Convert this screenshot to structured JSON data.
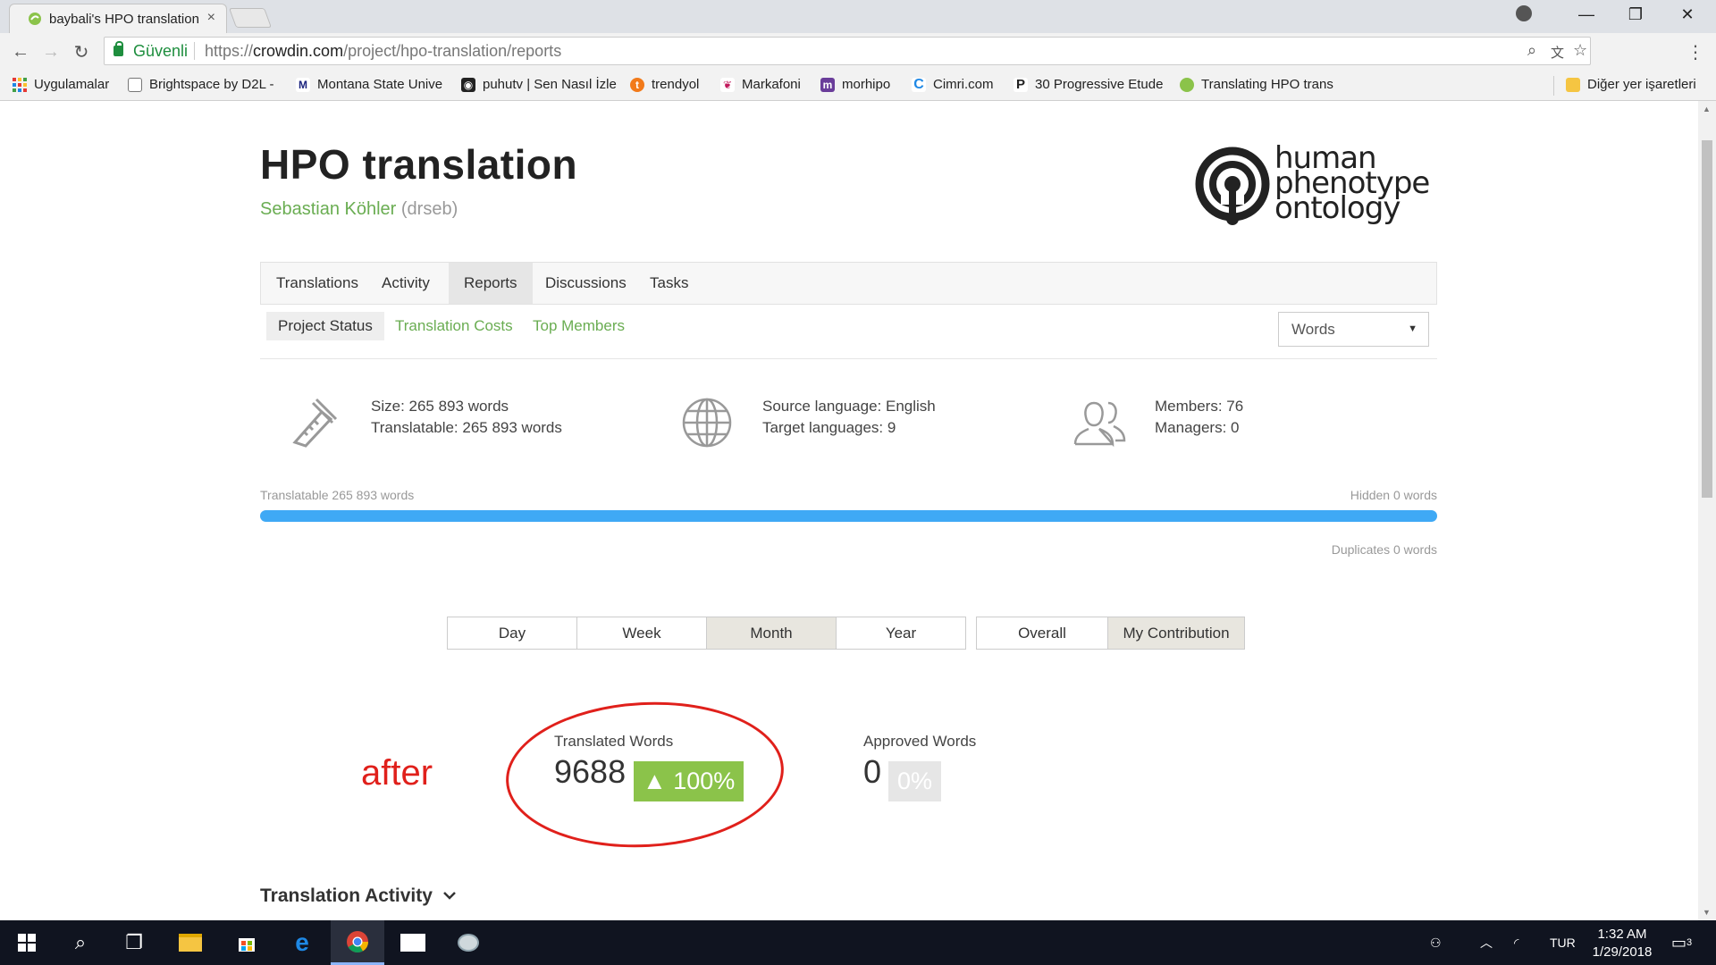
{
  "browser": {
    "tab_title": "baybali's HPO translation",
    "tab_close": "×",
    "window_controls": [
      "—",
      "❐",
      "✕"
    ],
    "secure_label": "Güvenli",
    "url_scheme": "https://",
    "url_host": "crowdin.com",
    "url_path": "/project/hpo-translation/reports",
    "bookmarks": [
      {
        "label": "Uygulamalar",
        "icon": "apps-grid-icon"
      },
      {
        "label": "Brightspace by D2L -",
        "icon": "page-icon"
      },
      {
        "label": "Montana State Unive",
        "icon": "m-logo-icon"
      },
      {
        "label": "puhutv | Sen Nasıl İzle",
        "icon": "puhutv-icon"
      },
      {
        "label": "trendyol",
        "icon": "trendyol-icon"
      },
      {
        "label": "Markafoni",
        "icon": "markafoni-icon"
      },
      {
        "label": "morhipo",
        "icon": "morhipo-icon"
      },
      {
        "label": "Cimri.com",
        "icon": "cimri-icon"
      },
      {
        "label": "30 Progressive Etude",
        "icon": "p-icon"
      },
      {
        "label": "Translating HPO trans",
        "icon": "crowdin-icon"
      }
    ],
    "other_bookmarks": "Diğer yer işaretleri"
  },
  "project": {
    "title": "HPO translation",
    "owner_name": "Sebastian Köhler",
    "owner_handle": "(drseb)",
    "logo_text": [
      "human",
      "phenotype",
      "ontology"
    ]
  },
  "main_tabs": [
    "Translations",
    "Activity",
    "Reports",
    "Discussions",
    "Tasks"
  ],
  "active_main_tab": "Reports",
  "sub_tabs": [
    "Project Status",
    "Translation Costs",
    "Top Members"
  ],
  "active_sub_tab": "Project Status",
  "unit_select": "Words",
  "stats": {
    "size": "Size: 265 893 words",
    "translatable": "Translatable: 265 893 words",
    "source_language": "Source language: English",
    "target_languages": "Target languages: 9",
    "members": "Members: 76",
    "managers": "Managers: 0"
  },
  "progress": {
    "left_label": "Translatable 265 893 words",
    "right_label": "Hidden 0 words",
    "duplicates": "Duplicates 0 words",
    "fill_fraction": 1.0
  },
  "period_buttons": [
    "Day",
    "Week",
    "Month",
    "Year"
  ],
  "active_period": "Month",
  "scope_buttons": [
    "Overall",
    "My Contribution"
  ],
  "active_scope": "My Contribution",
  "annotation": "after",
  "metrics": {
    "translated_label": "Translated Words",
    "translated_value": "9688",
    "translated_change": "▲ 100%",
    "approved_label": "Approved Words",
    "approved_value": "0",
    "approved_change": "0%"
  },
  "section_title": "Translation Activity",
  "taskbar": {
    "language": "TUR",
    "time": "1:32 AM",
    "date": "1/29/2018",
    "notifications": "3"
  },
  "colors": {
    "accent_green": "#6aad52",
    "progress_blue": "#3fa9f5",
    "badge_green": "#8bc34a",
    "annotation_red": "#e0201b"
  }
}
